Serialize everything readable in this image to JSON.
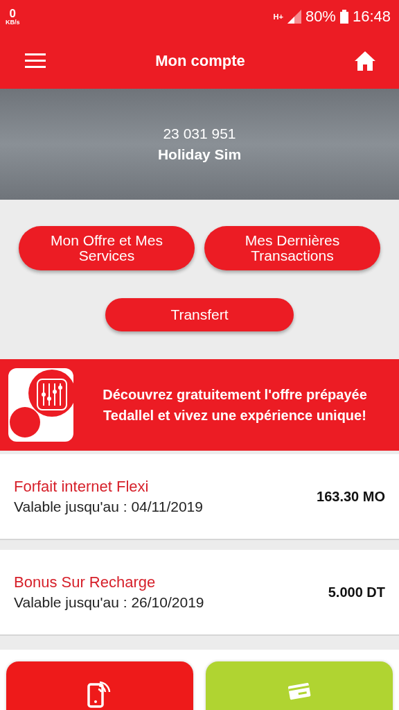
{
  "status_bar": {
    "speed_value": "0",
    "speed_unit": "KB/s",
    "network": "H+",
    "battery": "80%",
    "time": "16:48"
  },
  "header": {
    "title": "Mon compte"
  },
  "profile": {
    "number": "23 031 951",
    "name": "Holiday Sim"
  },
  "actions": [
    {
      "label": "Mon Offre et Mes Services"
    },
    {
      "label": "Mes Dernières Transactions"
    },
    {
      "label": "Transfert"
    }
  ],
  "banner": {
    "text": "Découvrez gratuitement l'offre prépayée Tedallel et vivez une expérience unique!"
  },
  "balances": [
    {
      "title": "Forfait internet Flexi",
      "validity": "Valable jusqu'au : 04/11/2019",
      "amount": "163.30 MO"
    },
    {
      "title": "Bonus Sur Recharge",
      "validity": "Valable jusqu'au : 26/10/2019",
      "amount": "5.000 DT"
    }
  ],
  "tiles": [
    {
      "kind": "phone",
      "color": "#ee1a1a"
    },
    {
      "kind": "card",
      "color": "#b0d431"
    }
  ]
}
